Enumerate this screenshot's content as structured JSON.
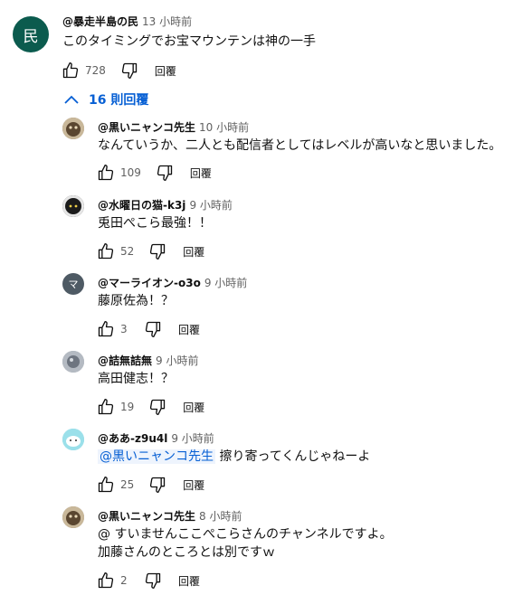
{
  "top_comment": {
    "author": "@暴走半島の民",
    "time": "13 小時前",
    "avatar_letter": "民",
    "text": "このタイミングでお宝マウンテンは神の一手",
    "likes": "728",
    "reply_label": "回覆"
  },
  "replies_toggle": {
    "label": "16 則回覆"
  },
  "replies": [
    {
      "author": "@黒いニャンコ先生",
      "time": "10 小時前",
      "lines": [
        "なんていうか、二人とも配信者としてはレベルが高いなと思いました。"
      ],
      "likes": "109",
      "reply_label": "回覆"
    },
    {
      "author": "@水曜日の猫-k3j",
      "time": "9 小時前",
      "lines": [
        "兎田ぺこら最強！！"
      ],
      "likes": "52",
      "reply_label": "回覆"
    },
    {
      "author": "@マーライオン-o3o",
      "time": "9 小時前",
      "avatar_letter": "マ",
      "lines": [
        "藤原佐為！？"
      ],
      "likes": "3",
      "reply_label": "回覆"
    },
    {
      "author": "@詰無詰無",
      "time": "9 小時前",
      "lines": [
        "高田健志！？"
      ],
      "likes": "19",
      "reply_label": "回覆"
    },
    {
      "author": "@ああ-z9u4l",
      "time": "9 小時前",
      "mention": "@黒いニャンコ先生",
      "lines": [
        "擦り寄ってくんじゃねーよ"
      ],
      "likes": "25",
      "reply_label": "回覆"
    },
    {
      "author": "@黒いニャンコ先生",
      "time": "8 小時前",
      "lines": [
        "@ すいませんここぺこらさんのチャンネルですよ。",
        "加藤さんのところとは別ですｗ"
      ],
      "likes": "2",
      "reply_label": "回覆"
    }
  ],
  "colors": {
    "accent": "#065fd4",
    "avatar_top": "#0b5b4e"
  }
}
